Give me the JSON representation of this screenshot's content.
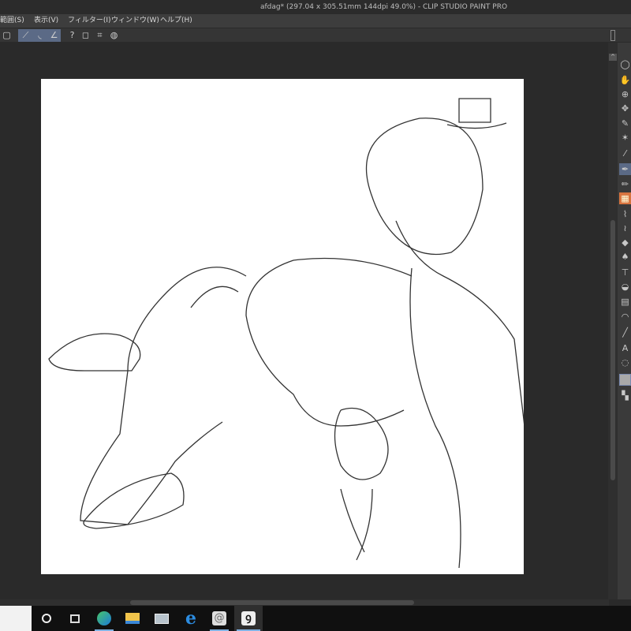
{
  "window": {
    "title": "afdag* (297.04 x 305.51mm 144dpi 49.0%)  - CLIP STUDIO PAINT PRO"
  },
  "menu": [
    "範囲(S)",
    "表示(V)",
    "フィルター(I)",
    "ウィンドウ(W)",
    "ヘルプ(H)"
  ],
  "toolbar": {
    "icons": [
      "checkbox-icon",
      "curve-line-icon",
      "curve-arc-icon",
      "curve-corner-icon",
      "help-icon",
      "transform-icon",
      "mesh-icon",
      "sphere-icon"
    ]
  },
  "tools": [
    "lasso-icon",
    "hand-icon",
    "rotate-icon",
    "move-icon",
    "selection-pen-icon",
    "magic-wand-icon",
    "eyedropper-icon",
    "pen-icon",
    "pencil-icon",
    "brush-icon",
    "airbrush-icon",
    "decoration-icon",
    "eraser-icon",
    "blend-icon",
    "fill-icon",
    "bucket-icon",
    "gradient-icon",
    "figure-icon",
    "ruler-icon",
    "text-icon",
    "balloon-icon",
    "color-swatch-icon",
    "transparent-icon"
  ],
  "taskbar": {
    "apps": [
      "cortana-icon",
      "task-view-icon",
      "edge-icon",
      "file-explorer-icon",
      "photos-icon",
      "internet-explorer-icon",
      "clip-studio-icon",
      "clip-studio-paint-icon"
    ]
  },
  "colors": {
    "accent": "#5b6a86",
    "taskbar_highlight": "#7fb1e3"
  }
}
